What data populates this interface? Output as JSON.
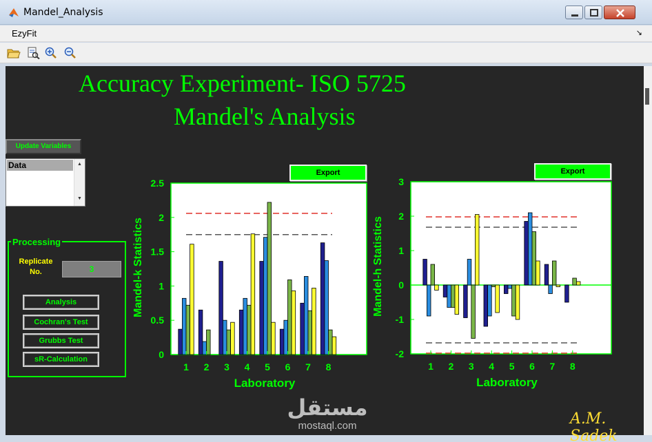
{
  "window": {
    "title": "Mandel_Analysis"
  },
  "menu": {
    "ezyfit": "EzyFit",
    "arrow": "↘"
  },
  "toolbar": {
    "icons": [
      "open-folder-icon",
      "print-preview-icon",
      "zoom-in-icon",
      "zoom-out-icon"
    ]
  },
  "heading": {
    "line1": "Accuracy Experiment- ISO 5725",
    "line2": "Mandel's Analysis"
  },
  "controls": {
    "update_label": "Update Variables",
    "list_item": "Data",
    "processing_title": "Processing",
    "replicate_label": "Replicate No.",
    "replicate_value": "3",
    "buttons": [
      "Analysis",
      "Cochran's Test",
      "Grubbs Test",
      "sR-Calculation"
    ],
    "export_label": "Export"
  },
  "signature": "A.M. Sadek",
  "watermark": {
    "logo": "مستقل",
    "text": "mostaql.com"
  },
  "colors": {
    "background": "#262626",
    "accent": "#00ff00",
    "series": [
      "#1f1f8f",
      "#2a8de0",
      "#7ab648",
      "#ffff33"
    ]
  },
  "chart_data": [
    {
      "type": "bar",
      "xlabel": "Laboratory",
      "ylabel": "Mandel-k Statistics",
      "categories": [
        "1",
        "2",
        "3",
        "4",
        "5",
        "6",
        "7",
        "8"
      ],
      "ylim": [
        0,
        2.5
      ],
      "yticks": [
        "0",
        "0.5",
        "1",
        "1.5",
        "2",
        "2.5"
      ],
      "series": [
        {
          "values": [
            0.37,
            0.65,
            1.36,
            0.65,
            1.36,
            0.37,
            0.75,
            1.63
          ]
        },
        {
          "values": [
            0.82,
            0.19,
            0.5,
            0.82,
            1.71,
            0.5,
            1.14,
            1.37
          ]
        },
        {
          "values": [
            0.72,
            0.36,
            0.36,
            0.72,
            2.22,
            1.09,
            0.64,
            0.36
          ]
        },
        {
          "values": [
            1.61,
            0.0,
            0.47,
            1.76,
            0.47,
            0.93,
            0.97,
            0.26
          ]
        }
      ],
      "reference_lines": [
        {
          "value": 2.06,
          "color": "#e0302a"
        },
        {
          "value": 1.75,
          "color": "#555555"
        }
      ]
    },
    {
      "type": "bar",
      "xlabel": "Laboratory",
      "ylabel": "Mandel-h Statistics",
      "categories": [
        "1",
        "2",
        "3",
        "4",
        "5",
        "6",
        "7",
        "8"
      ],
      "ylim": [
        -2,
        3
      ],
      "yticks": [
        "-2",
        "-1",
        "0",
        "1",
        "2",
        "3"
      ],
      "series": [
        {
          "values": [
            0.75,
            -0.35,
            -0.95,
            -1.2,
            -0.25,
            1.85,
            0.6,
            -0.5
          ]
        },
        {
          "values": [
            -0.9,
            -0.65,
            0.75,
            -0.9,
            -0.1,
            2.1,
            -0.25,
            0.0
          ]
        },
        {
          "values": [
            0.6,
            -0.65,
            -1.55,
            -0.05,
            -0.9,
            1.55,
            0.7,
            0.2
          ]
        },
        {
          "values": [
            -0.15,
            -0.85,
            2.05,
            -0.8,
            -1.0,
            0.7,
            -0.05,
            0.1
          ]
        }
      ],
      "reference_lines": [
        {
          "value": 1.98,
          "color": "#e0302a"
        },
        {
          "value": 1.68,
          "color": "#555555"
        },
        {
          "value": -1.68,
          "color": "#555555"
        },
        {
          "value": -1.98,
          "color": "#e0302a"
        }
      ]
    }
  ]
}
